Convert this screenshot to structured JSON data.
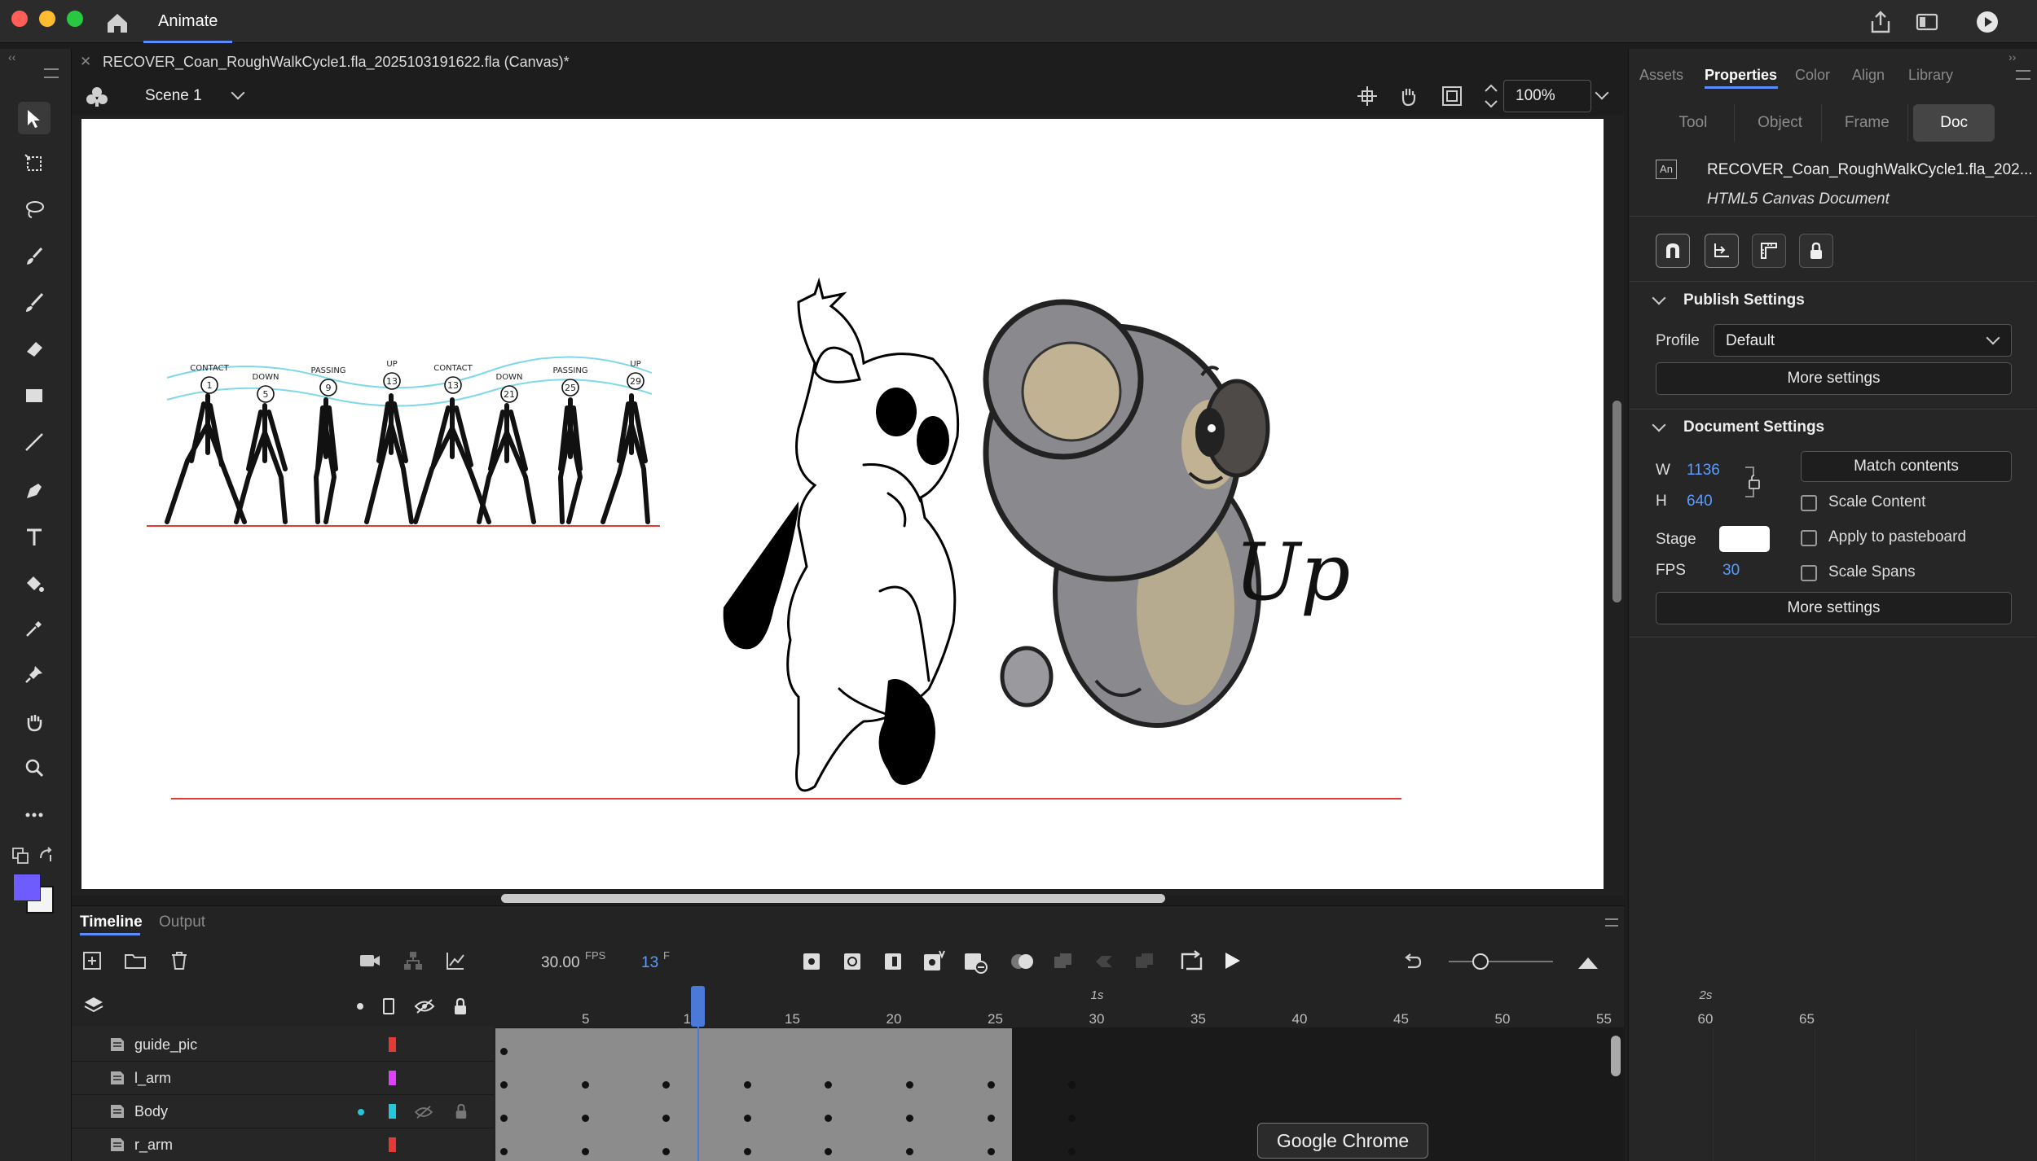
{
  "app": {
    "tab_label": "Animate"
  },
  "document": {
    "title": "RECOVER_Coan_RoughWalkCycle1.fla_2025103191622.fla (Canvas)*"
  },
  "scene": {
    "label": "Scene 1",
    "zoom": "100%"
  },
  "panel": {
    "tabs": [
      "Assets",
      "Properties",
      "Color",
      "Align",
      "Library"
    ],
    "subtabs": [
      "Tool",
      "Object",
      "Frame",
      "Doc"
    ],
    "doc_name": "RECOVER_Coan_RoughWalkCycle1.fla_202...",
    "doc_type": "HTML5 Canvas Document",
    "an_badge": "An",
    "publish": {
      "header": "Publish Settings",
      "profile_label": "Profile",
      "profile_value": "Default",
      "more": "More settings"
    },
    "docset": {
      "header": "Document Settings",
      "w_label": "W",
      "w_value": "1136",
      "h_label": "H",
      "h_value": "640",
      "stage_label": "Stage",
      "fps_label": "FPS",
      "fps_value": "30",
      "match": "Match contents",
      "scale_content": "Scale Content",
      "apply_pasteboard": "Apply to pasteboard",
      "scale_spans": "Scale Spans",
      "more": "More settings"
    }
  },
  "timeline": {
    "tabs": [
      "Timeline",
      "Output"
    ],
    "fps_value": "30.00",
    "fps_unit": "FPS",
    "frame_value": "13",
    "frame_unit": "F",
    "seconds": [
      "1s",
      "2s"
    ],
    "ruler": [
      "5",
      "10",
      "15",
      "20",
      "25",
      "30",
      "35",
      "40",
      "45",
      "50",
      "55",
      "60",
      "65"
    ],
    "layers": [
      {
        "name": "guide_pic",
        "color": "#e53935"
      },
      {
        "name": "l_arm",
        "color": "#e040fb"
      },
      {
        "name": "Body",
        "color": "#26c6da"
      },
      {
        "name": "r_arm",
        "color": "#e53935"
      }
    ]
  },
  "canvas": {
    "ref_labels": [
      "CONTACT",
      "DOWN",
      "PASSING",
      "UP",
      "CONTACT",
      "DOWN",
      "PASSING",
      "UP"
    ],
    "ref_numbers": [
      "1",
      "5",
      "9",
      "13",
      "13",
      "21",
      "25",
      "29"
    ],
    "sketch_text": "Up"
  },
  "tooltip": {
    "text": "Google Chrome"
  }
}
